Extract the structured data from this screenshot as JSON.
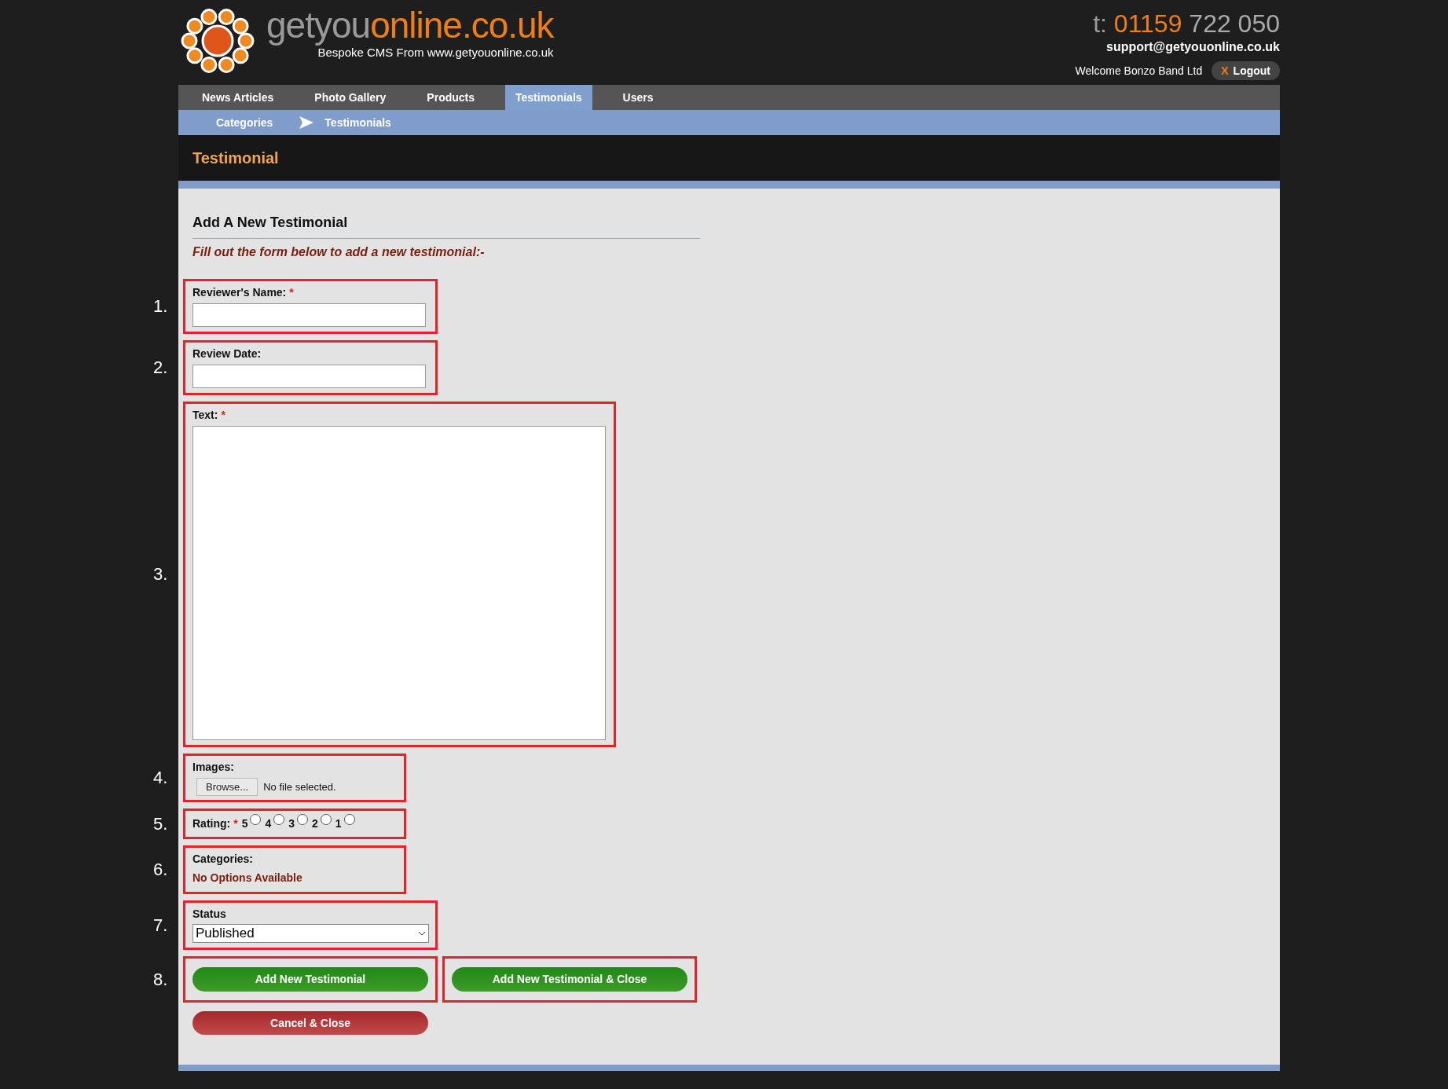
{
  "header": {
    "brand_gray": "getyou",
    "brand_orange": "online.co.uk",
    "tagline": "Bespoke CMS From www.getyouonline.co.uk",
    "phone_prefix": "t:",
    "phone_area": "01159",
    "phone_number": "722 050",
    "email": "support@getyouonline.co.uk",
    "welcome": "Welcome Bonzo Band Ltd",
    "logout": {
      "icon": "X",
      "label": "Logout"
    }
  },
  "nav": [
    {
      "label": "News Articles",
      "selected": false
    },
    {
      "label": "Photo Gallery",
      "selected": false
    },
    {
      "label": "Products",
      "selected": false
    },
    {
      "label": "Testimonials",
      "selected": true
    },
    {
      "label": "Users",
      "selected": false
    }
  ],
  "subnav": [
    {
      "label": "Categories",
      "selected": false
    },
    {
      "label": "Testimonials",
      "selected": true
    }
  ],
  "page_title": "Testimonial",
  "form": {
    "heading": "Add A New Testimonial",
    "intro": "Fill out the form below to add a new testimonial:-",
    "required_mark": "*",
    "fields": [
      {
        "number": "1.",
        "kind": "text",
        "label": "Reviewer's Name:",
        "required": true
      },
      {
        "number": "2.",
        "kind": "text",
        "label": "Review Date:",
        "required": false
      },
      {
        "number": "3.",
        "kind": "textarea",
        "label": "Text:",
        "required": true
      },
      {
        "number": "4.",
        "kind": "file",
        "label": "Images:",
        "required": false,
        "button": "Browse...",
        "status": "No file selected."
      },
      {
        "number": "5.",
        "kind": "rating",
        "label": "Rating:",
        "required": true,
        "options": [
          {
            "label": "5",
            "selected": false
          },
          {
            "label": "4",
            "selected": false
          },
          {
            "label": "3",
            "selected": false
          },
          {
            "label": "2",
            "selected": false
          },
          {
            "label": "1",
            "selected": false
          }
        ]
      },
      {
        "number": "6.",
        "kind": "message",
        "label": "Categories:",
        "required": false,
        "message": "No Options Available"
      },
      {
        "number": "7.",
        "kind": "select",
        "label": "Status",
        "required": false,
        "value": "Published"
      },
      {
        "number": "8.",
        "kind": "buttons",
        "buttons": [
          {
            "label": "Add New Testimonial",
            "kind": "primary"
          },
          {
            "label": "Add New Testimonial & Close",
            "kind": "primary"
          }
        ]
      }
    ],
    "cancel": {
      "label": "Cancel & Close",
      "kind": "danger"
    }
  }
}
